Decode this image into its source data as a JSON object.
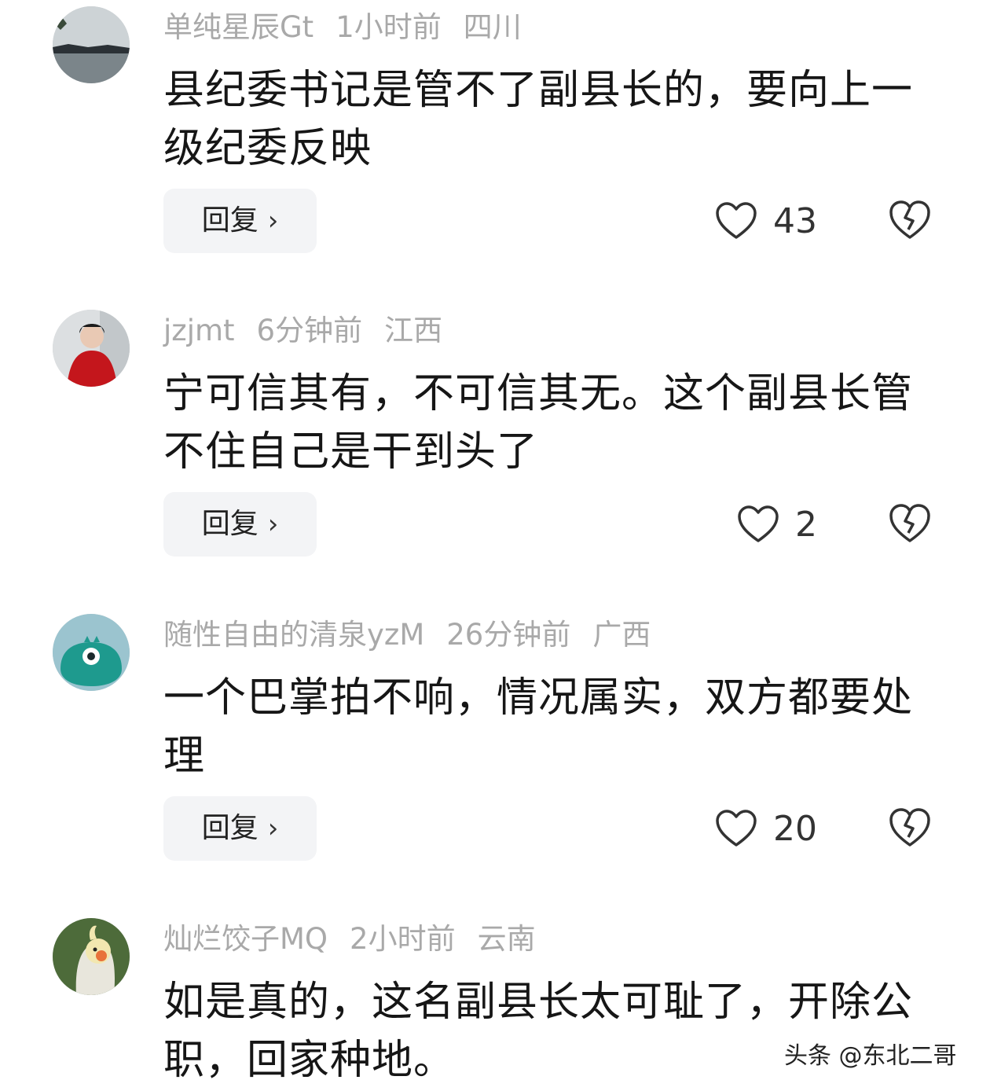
{
  "comments": [
    {
      "username": "单纯星辰Gt",
      "time": "1小时前",
      "location": "四川",
      "text": "县纪委书记是管不了副县长的，要向上一级纪委反映",
      "reply_label": "回复",
      "likes": "43",
      "avatar": "lake-landscape"
    },
    {
      "username": "jzjmt",
      "time": "6分钟前",
      "location": "江西",
      "text": "宁可信其有，不可信其无。这个副县长管不住自己是干到头了",
      "reply_label": "回复",
      "likes": "2",
      "avatar": "person-in-red"
    },
    {
      "username": "随性自由的清泉yzM",
      "time": "26分钟前",
      "location": "广西",
      "text": "一个巴掌拍不响，情况属实，双方都要处理",
      "reply_label": "回复",
      "likes": "20",
      "avatar": "teal-cartoon-creature"
    },
    {
      "username": "灿烂饺子MQ",
      "time": "2小时前",
      "location": "云南",
      "text": "如是真的，这名副县长太可耻了，开除公职，回家种地。",
      "avatar": "cockatiel-bird"
    }
  ],
  "icons": {
    "like": "heart-outline-icon",
    "dislike": "broken-heart-icon",
    "reply": "chevron-right-icon"
  },
  "watermark": "头条 @东北二哥",
  "colors": {
    "meta": "#a9a9a9",
    "text": "#161616",
    "reply_bg": "#f3f4f6"
  }
}
